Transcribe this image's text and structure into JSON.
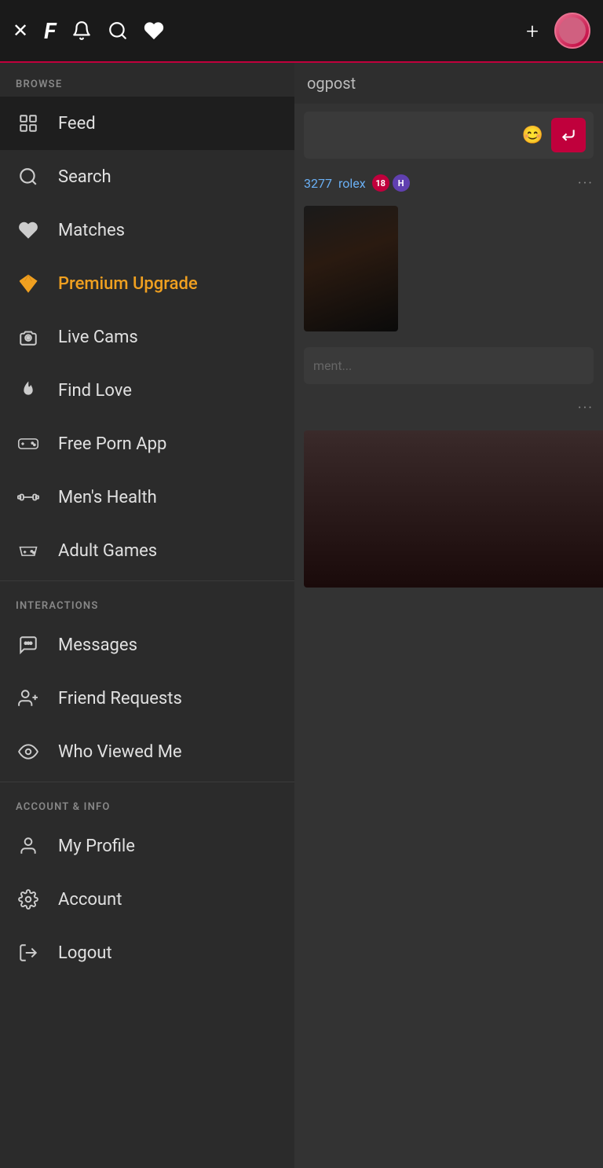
{
  "topbar": {
    "close_label": "✕",
    "logo_label": "F",
    "bell_label": "🔔",
    "search_label": "🔍",
    "heart_label": "♥",
    "plus_label": "+",
    "avatar_alt": "user avatar"
  },
  "sidebar": {
    "browse_section": "BROWSE",
    "interactions_section": "INTERACTIONS",
    "account_section": "ACCOUNT & INFO",
    "items": [
      {
        "id": "feed",
        "label": "Feed",
        "icon": "feed"
      },
      {
        "id": "search",
        "label": "Search",
        "icon": "search"
      },
      {
        "id": "matches",
        "label": "Matches",
        "icon": "heart"
      },
      {
        "id": "premium",
        "label": "Premium Upgrade",
        "icon": "diamond",
        "premium": true
      },
      {
        "id": "livecams",
        "label": "Live Cams",
        "icon": "camera"
      },
      {
        "id": "findlove",
        "label": "Find Love",
        "icon": "flame"
      },
      {
        "id": "freeporn",
        "label": "Free Porn App",
        "icon": "gamepad"
      },
      {
        "id": "menshealth",
        "label": "Men's Health",
        "icon": "dumbbell"
      },
      {
        "id": "adultgames",
        "label": "Adult Games",
        "icon": "controller"
      },
      {
        "id": "messages",
        "label": "Messages",
        "icon": "chat"
      },
      {
        "id": "friendrequests",
        "label": "Friend Requests",
        "icon": "adduser"
      },
      {
        "id": "whoviewed",
        "label": "Who Viewed Me",
        "icon": "eye"
      },
      {
        "id": "myprofile",
        "label": "My Profile",
        "icon": "person"
      },
      {
        "id": "account",
        "label": "Account",
        "icon": "gear"
      },
      {
        "id": "logout",
        "label": "Logout",
        "icon": "power"
      }
    ]
  },
  "content": {
    "blogpost_text": "ogpost",
    "post1_username": "3277",
    "post1_name": "rolex",
    "post1_badge1": "18",
    "post1_badge2": "H",
    "post1_more": "···",
    "comment_placeholder": "ment...",
    "post2_more": "···"
  }
}
